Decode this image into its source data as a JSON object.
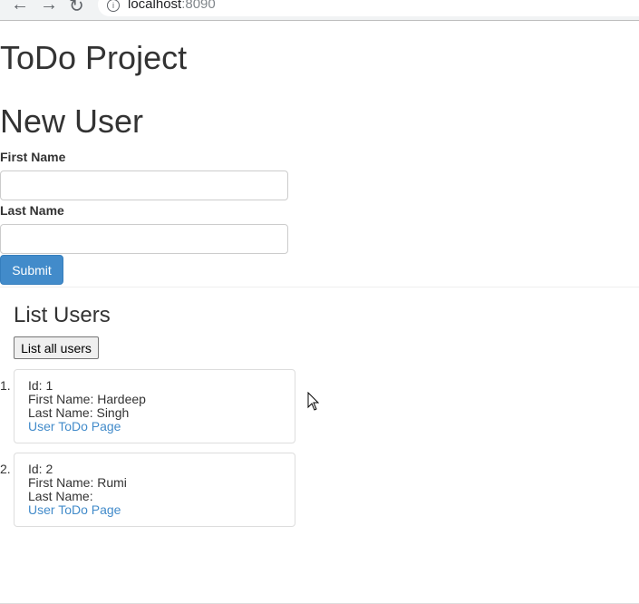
{
  "browser": {
    "url_host": "localhost",
    "url_port": ":8090"
  },
  "page_title": "ToDo Project",
  "form": {
    "heading": "New User",
    "first_name_label": "First Name",
    "last_name_label": "Last Name",
    "first_name_value": "",
    "last_name_value": "",
    "submit_label": "Submit"
  },
  "list": {
    "heading": "List Users",
    "list_all_label": "List all users",
    "users": [
      {
        "num": "1.",
        "id": "Id: 1",
        "first": "First Name: Hardeep",
        "last": "Last Name: Singh",
        "link": "User ToDo Page"
      },
      {
        "num": "2.",
        "id": "Id: 2",
        "first": "First Name: Rumi",
        "last": "Last Name:",
        "link": "User ToDo Page"
      }
    ]
  }
}
